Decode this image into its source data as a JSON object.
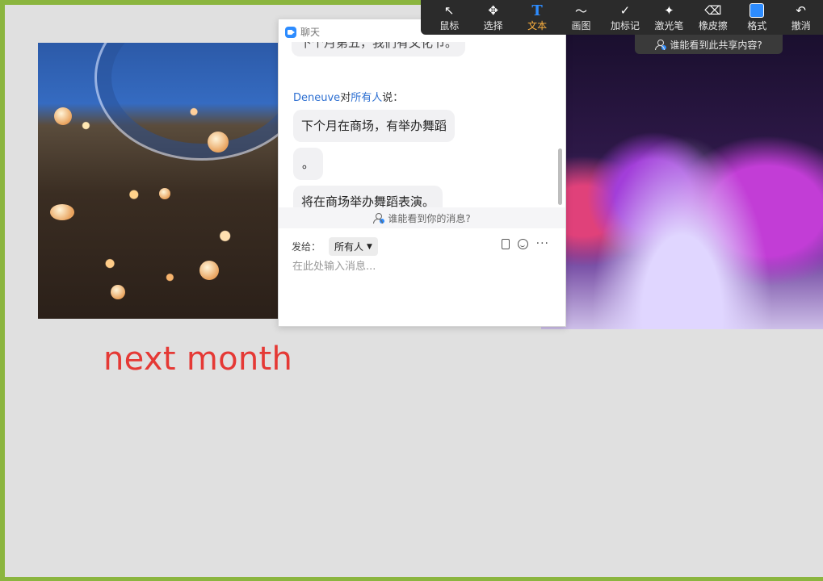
{
  "overlay_text": "next month",
  "chat": {
    "title": "聊天",
    "partial_message": "下个月第五，我们有文化节。",
    "sender_name": "Deneuve",
    "sender_to_word": "对",
    "sender_target": "所有人",
    "sender_suffix": "说：",
    "messages": [
      "下个月在商场，有举办舞蹈",
      "。",
      "将在商场举办舞蹈表演。"
    ],
    "who_sees": "谁能看到你的消息?",
    "send_to_label": "发给：",
    "recipient": "所有人",
    "input_placeholder": "在此处输入消息..."
  },
  "toolbar": {
    "tools": [
      {
        "label": "鼠标",
        "icon": "cursor-icon",
        "glyph": "↖"
      },
      {
        "label": "选择",
        "icon": "move-icon",
        "glyph": "✥"
      },
      {
        "label": "文本",
        "icon": "text-icon",
        "glyph": "T",
        "active": true
      },
      {
        "label": "画图",
        "icon": "draw-icon",
        "glyph": "〜"
      },
      {
        "label": "加标记",
        "icon": "stamp-icon",
        "glyph": "✓"
      },
      {
        "label": "激光笔",
        "icon": "laser-icon",
        "glyph": "✦"
      },
      {
        "label": "橡皮擦",
        "icon": "eraser-icon",
        "glyph": "⌫"
      },
      {
        "label": "格式",
        "icon": "format-icon",
        "glyph": ""
      },
      {
        "label": "撤消",
        "icon": "undo-icon",
        "glyph": "↶"
      }
    ],
    "share_who": "谁能看到此共享内容?"
  },
  "colors": {
    "accent": "#2d8cff",
    "active_label": "#ffb23f",
    "overlay_text": "#e53935",
    "frame": "#8bb53f"
  }
}
